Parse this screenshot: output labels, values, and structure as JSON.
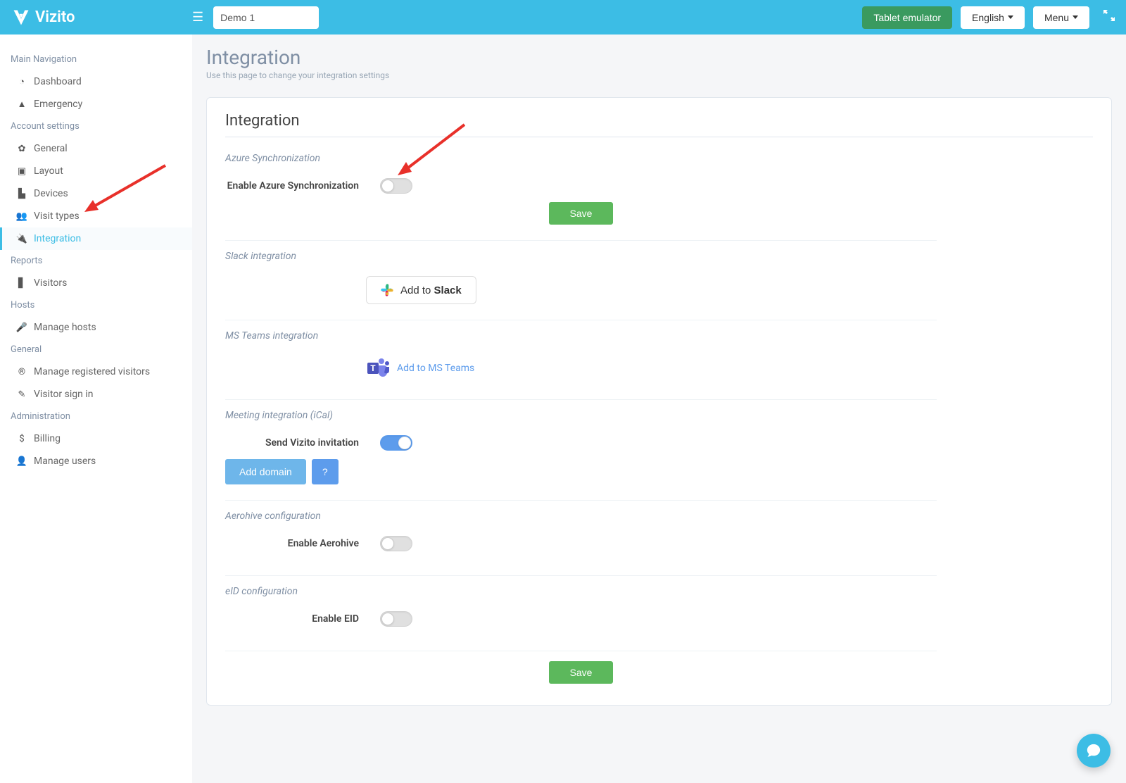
{
  "header": {
    "logo_text": "Vizito",
    "site_value": "Demo 1",
    "tablet_emulator": "Tablet emulator",
    "language": "English",
    "menu": "Menu"
  },
  "sidebar": {
    "main_nav": "Main Navigation",
    "dashboard": "Dashboard",
    "emergency": "Emergency",
    "account_settings": "Account settings",
    "general": "General",
    "layout": "Layout",
    "devices": "Devices",
    "visit_types": "Visit types",
    "integration": "Integration",
    "reports": "Reports",
    "visitors": "Visitors",
    "hosts": "Hosts",
    "manage_hosts": "Manage hosts",
    "general2": "General",
    "manage_registered": "Manage registered visitors",
    "visitor_signin": "Visitor sign in",
    "administration": "Administration",
    "billing": "Billing",
    "manage_users": "Manage users"
  },
  "page": {
    "title": "Integration",
    "subtitle": "Use this page to change your integration settings"
  },
  "panel": {
    "title": "Integration",
    "azure": {
      "section": "Azure Synchronization",
      "label": "Enable Azure Synchronization",
      "save": "Save"
    },
    "slack": {
      "section": "Slack integration",
      "add_prefix": "Add to ",
      "add_bold": "Slack"
    },
    "teams": {
      "section": "MS Teams integration",
      "link": "Add to MS Teams"
    },
    "ical": {
      "section": "Meeting integration (iCal)",
      "label": "Send Vizito invitation",
      "add_domain": "Add domain",
      "help": "?"
    },
    "aerohive": {
      "section": "Aerohive configuration",
      "label": "Enable Aerohive"
    },
    "eid": {
      "section": "eID configuration",
      "label": "Enable EID"
    },
    "save_bottom": "Save"
  }
}
